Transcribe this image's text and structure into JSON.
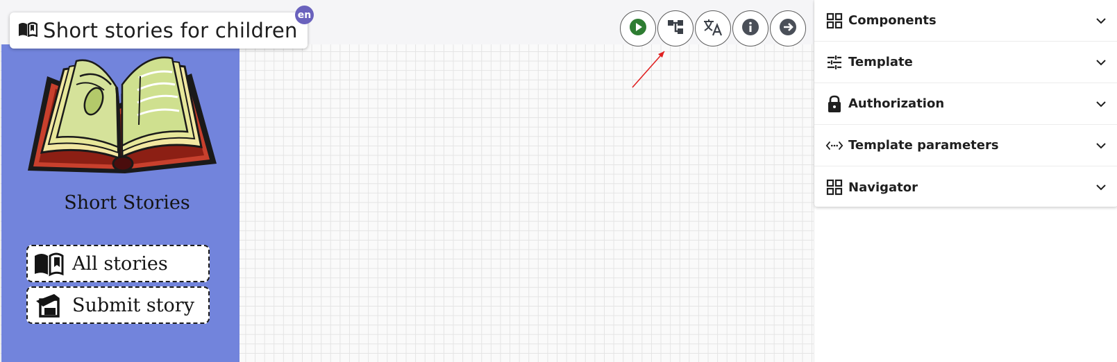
{
  "header": {
    "title": "Short stories for children",
    "language_badge": "en"
  },
  "toolbar": {
    "buttons": [
      {
        "name": "run",
        "icon": "play-circle-icon",
        "color": "#2e7d32"
      },
      {
        "name": "structure",
        "icon": "tree-structure-icon"
      },
      {
        "name": "translate",
        "icon": "translate-icon"
      },
      {
        "name": "info",
        "icon": "info-circle-icon"
      },
      {
        "name": "next",
        "icon": "arrow-right-circle-icon"
      }
    ]
  },
  "template_preview": {
    "heading": "Short Stories",
    "menu": [
      {
        "label": "All stories",
        "icon": "open-book-icon"
      },
      {
        "label": "Submit story",
        "icon": "edit-document-icon"
      }
    ],
    "background_color": "#7284dc"
  },
  "side_panel": {
    "sections": [
      {
        "label": "Components",
        "icon": "grid-icon"
      },
      {
        "label": "Template",
        "icon": "sliders-icon"
      },
      {
        "label": "Authorization",
        "icon": "lock-icon"
      },
      {
        "label": "Template parameters",
        "icon": "code-arrows-icon"
      },
      {
        "label": "Navigator",
        "icon": "grid-icon"
      }
    ]
  }
}
